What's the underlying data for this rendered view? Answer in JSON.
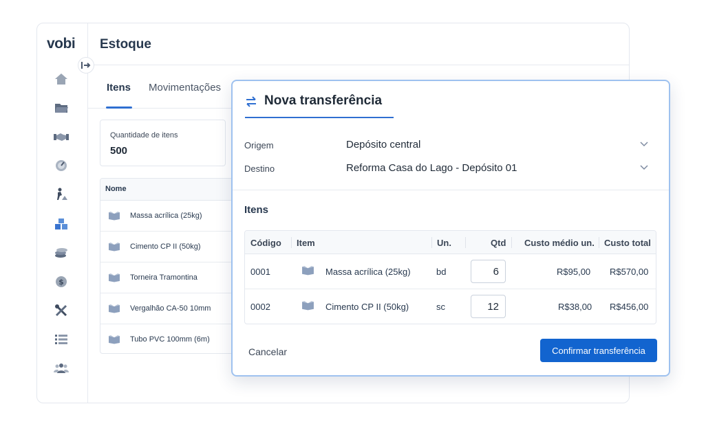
{
  "brand": {
    "logo": "vobi"
  },
  "page": {
    "title": "Estoque"
  },
  "tabs": [
    {
      "label": "Itens",
      "active": true
    },
    {
      "label": "Movimentações",
      "active": false
    }
  ],
  "stat": {
    "label": "Quantidade de itens",
    "value": "500"
  },
  "stock_table": {
    "header": "Nome",
    "rows": [
      {
        "name": "Massa acrílica (25kg)"
      },
      {
        "name": "Cimento CP II (50kg)"
      },
      {
        "name": "Torneira Tramontina"
      },
      {
        "name": "Vergalhão CA-50 10mm"
      },
      {
        "name": "Tubo PVC 100mm (6m)"
      }
    ]
  },
  "sidebar": {
    "icons": [
      "home-icon",
      "folder-icon",
      "handshake-icon",
      "gauge-icon",
      "worker-icon",
      "boxes-icon",
      "coins-icon",
      "dollar-icon",
      "tools-icon",
      "list-icon",
      "team-icon"
    ]
  },
  "modal": {
    "title": "Nova transferência",
    "origin_label": "Origem",
    "origin_value": "Depósito central",
    "destination_label": "Destino",
    "destination_value": "Reforma Casa do Lago - Depósito 01",
    "section_title": "Itens",
    "columns": {
      "code": "Código",
      "item": "Item",
      "unit": "Un.",
      "qty": "Qtd",
      "avg_cost": "Custo médio un.",
      "total_cost": "Custo total"
    },
    "rows": [
      {
        "code": "0001",
        "item": "Massa acrílica (25kg)",
        "unit": "bd",
        "qty": "6",
        "avg_cost": "R$95,00",
        "total_cost": "R$570,00"
      },
      {
        "code": "0002",
        "item": "Cimento CP II (50kg)",
        "unit": "sc",
        "qty": "12",
        "avg_cost": "R$38,00",
        "total_cost": "R$456,00"
      }
    ],
    "cancel_label": "Cancelar",
    "confirm_label": "Confirmar transferência"
  },
  "colors": {
    "accent": "#2f6fd1",
    "primary_button": "#1264cf",
    "modal_border": "#9ec1ef"
  }
}
